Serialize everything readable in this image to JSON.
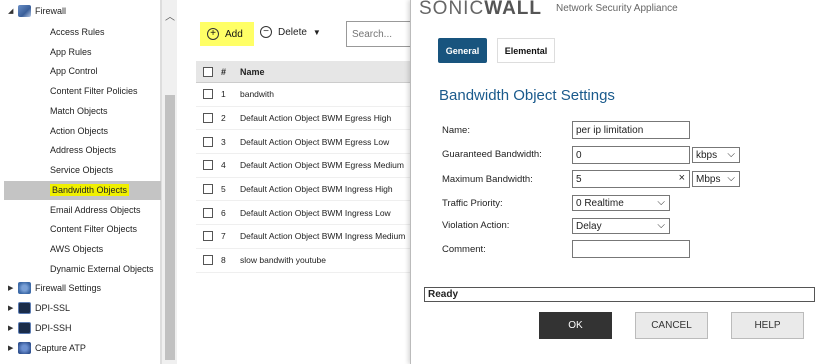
{
  "sidebar": {
    "firewall_label": "Firewall",
    "children": [
      "Access Rules",
      "App Rules",
      "App Control",
      "Content Filter Policies",
      "Match Objects",
      "Action Objects",
      "Address Objects",
      "Service Objects",
      "Bandwidth Objects",
      "Email Address Objects",
      "Content Filter Objects",
      "AWS Objects",
      "Dynamic External Objects"
    ],
    "top_items": [
      "Firewall Settings",
      "DPI-SSL",
      "DPI-SSH",
      "Capture ATP"
    ]
  },
  "toolbar": {
    "add_label": "Add",
    "delete_label": "Delete",
    "search_placeholder": "Search..."
  },
  "table": {
    "headers": [
      "#",
      "Name"
    ],
    "rows": [
      {
        "num": "1",
        "name": "bandwith"
      },
      {
        "num": "2",
        "name": "Default Action Object BWM Egress High"
      },
      {
        "num": "3",
        "name": "Default Action Object BWM Egress Low"
      },
      {
        "num": "4",
        "name": "Default Action Object BWM Egress Medium"
      },
      {
        "num": "5",
        "name": "Default Action Object BWM Ingress High"
      },
      {
        "num": "6",
        "name": "Default Action Object BWM Ingress Low"
      },
      {
        "num": "7",
        "name": "Default Action Object BWM Ingress Medium"
      },
      {
        "num": "8",
        "name": "slow bandwith youtube"
      }
    ]
  },
  "dialog": {
    "brand_light": "SONIC",
    "brand_bold": "WALL",
    "tagline": "Network Security Appliance",
    "tab_general": "General",
    "tab_elemental": "Elemental",
    "heading": "Bandwidth Object Settings",
    "name_label": "Name:",
    "name_value": "per ip limitation",
    "guaranteed_label": "Guaranteed Bandwidth:",
    "guaranteed_value": "0",
    "guaranteed_unit": "kbps",
    "maximum_label": "Maximum Bandwidth:",
    "maximum_value": "5",
    "maximum_unit": "Mbps",
    "clear_glyph": "×",
    "priority_label": "Traffic Priority:",
    "priority_value": "0 Realtime",
    "violation_label": "Violation Action:",
    "violation_value": "Delay",
    "comment_label": "Comment:",
    "comment_value": "",
    "status": "Ready",
    "ok": "OK",
    "cancel": "CANCEL",
    "help": "HELP"
  },
  "colors": {
    "highlight_yellow": "#ffff66",
    "selected_row_gray": "#c4c4c4",
    "tab_active": "#18547e",
    "heading_blue": "#1a5a8c",
    "ok_button": "#333333"
  }
}
